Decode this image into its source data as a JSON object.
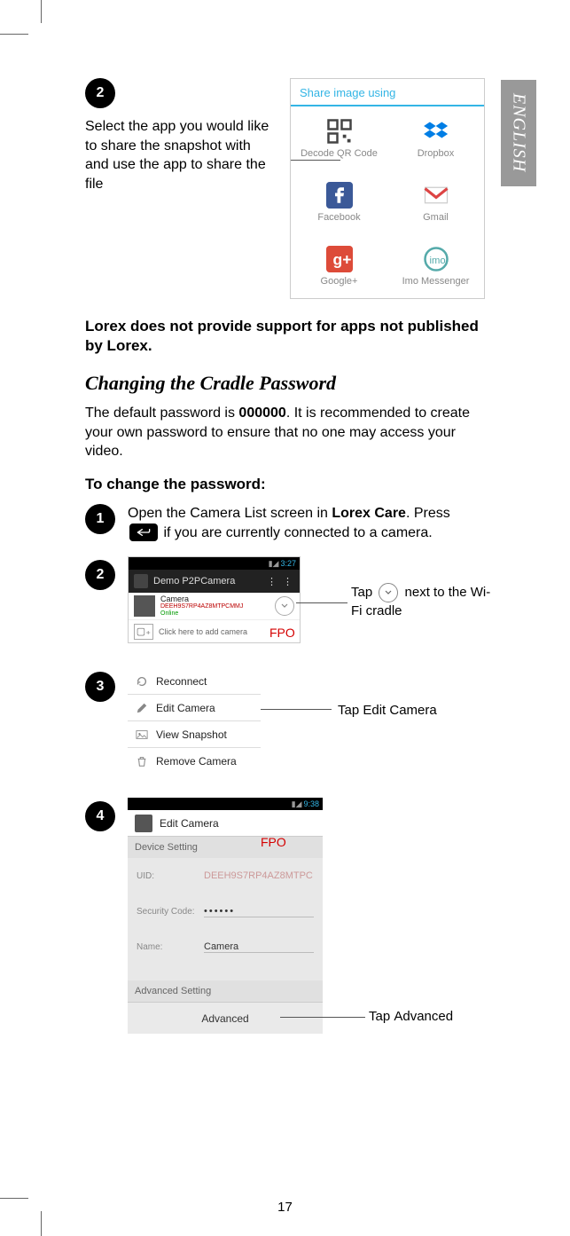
{
  "lang_tab": "ENGLISH",
  "share_dialog": {
    "title": "Share image using",
    "apps": [
      {
        "name": "Decode QR Code"
      },
      {
        "name": "Dropbox"
      },
      {
        "name": "Facebook"
      },
      {
        "name": "Gmail"
      },
      {
        "name": "Google+"
      },
      {
        "name": "Imo Messenger"
      }
    ]
  },
  "step2a": {
    "num": "2",
    "text": "Select the app you would like to share the snapshot with and use the app to share the file"
  },
  "support_note": "Lorex does not provide support for apps not published by Lorex.",
  "section_title": "Changing the Cradle Password",
  "section_intro_pre": "The default password is ",
  "section_intro_pw": "000000",
  "section_intro_post": ". It is recommended to create your own password to ensure that no one may access your video.",
  "subheading": "To change the password:",
  "step1": {
    "num": "1",
    "pre": "Open the Camera List screen in ",
    "app": "Lorex Care",
    "mid": ". Press ",
    "post": " if you are currently connected to a camera."
  },
  "step2b": {
    "num": "2",
    "callout_pre": "Tap ",
    "callout_post": " next to the Wi-Fi cradle",
    "fpo": "FPO",
    "phone": {
      "time": "3:27",
      "title": "Demo P2PCamera",
      "cam_name": "Camera",
      "cam_uid": "DEEH9S7RP4AZ8MTPCMMJ",
      "cam_status": "Online",
      "add_text": "Click here to add camera"
    }
  },
  "step3": {
    "num": "3",
    "callout_pre": "Tap ",
    "callout_bold": "Edit Camera",
    "menu": [
      "Reconnect",
      "Edit Camera",
      "View Snapshot",
      "Remove Camera"
    ]
  },
  "step4": {
    "num": "4",
    "fpo": "FPO",
    "callout_pre": "Tap ",
    "callout_bold": "Advanced",
    "editor": {
      "time": "9:38",
      "title": "Edit Camera",
      "sec1": "Device Setting",
      "uid_label": "UID:",
      "uid_value": "DEEH9S7RP4AZ8MTPC",
      "code_label": "Security Code:",
      "code_value": "••••••",
      "name_label": "Name:",
      "name_value": "Camera",
      "sec2": "Advanced Setting",
      "adv_btn": "Advanced"
    }
  },
  "page_number": "17"
}
